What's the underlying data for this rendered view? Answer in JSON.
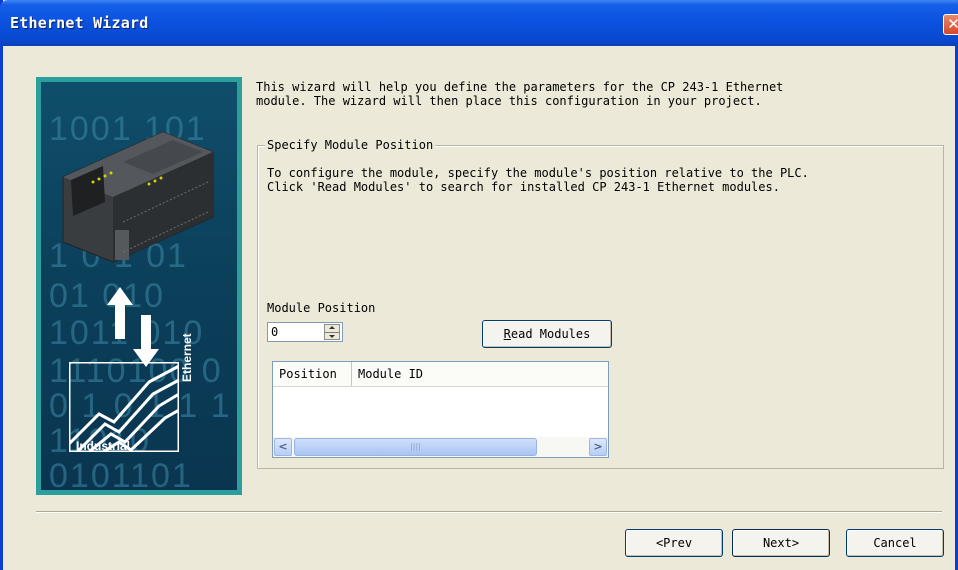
{
  "window": {
    "title": "Ethernet Wizard",
    "close_glyph": "✕"
  },
  "banner": {
    "binary_rows": [
      "1001  101",
      "1  0  1  01",
      "01    010",
      "1011  010",
      "1110100 0",
      "0 1 0 1 1 1",
      "11010",
      "0101101"
    ],
    "industrial_text": "Industrial",
    "ethernet_text": "Ethernet"
  },
  "intro_text": "This wizard will help you define the parameters for the CP 243-1 Ethernet\nmodule. The wizard will then place this configuration in your project.",
  "group": {
    "title": "Specify Module Position",
    "description": "To configure the module, specify the module's position relative to the PLC.\nClick 'Read Modules' to search for installed CP 243-1 Ethernet modules."
  },
  "module_position": {
    "label": "Module Position",
    "value": "0"
  },
  "read_modules": {
    "pre": "",
    "mnemonic": "R",
    "post": "ead Modules"
  },
  "listview": {
    "columns": [
      "Position",
      "Module ID"
    ],
    "scroll_thumb_glyph": "||||"
  },
  "buttons": {
    "prev": "<Prev",
    "next": "Next>",
    "cancel": "Cancel"
  },
  "scroll_glyphs": {
    "left": "<",
    "right": ">"
  }
}
